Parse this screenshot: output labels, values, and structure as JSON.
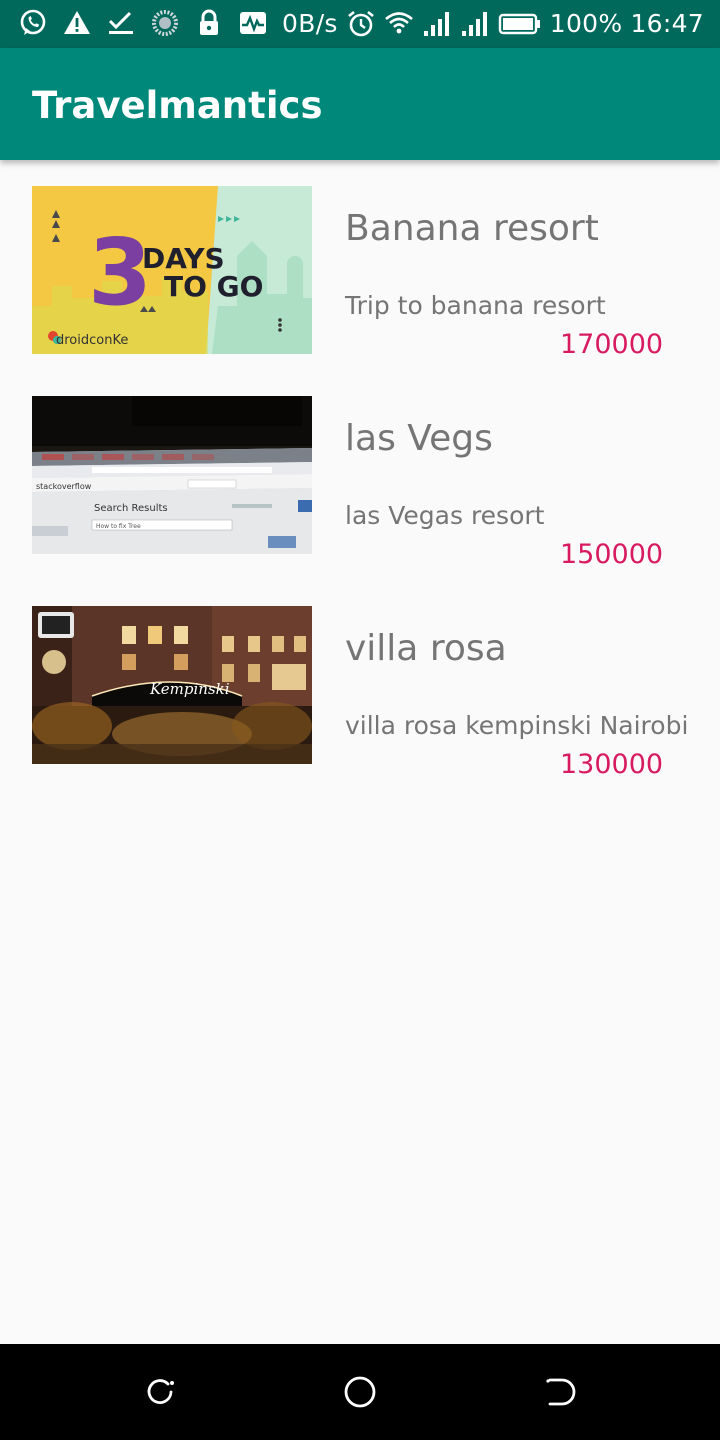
{
  "status_bar": {
    "left_icons": [
      "whatsapp-icon",
      "warning-icon",
      "checklist-icon",
      "sync-circle-icon",
      "lock-icon",
      "activity-icon"
    ],
    "net_speed": "0B/s",
    "right_icons": [
      "alarm-icon",
      "wifi-icon",
      "signal-icon",
      "signal-icon",
      "battery-icon"
    ],
    "battery": "100%",
    "time": "16:47",
    "color": "#00695c"
  },
  "app_bar": {
    "title": "Travelmantics",
    "color": "#00897b"
  },
  "deals": [
    {
      "title": "Banana resort",
      "description": "Trip to banana resort",
      "price": "170000",
      "image": {
        "name": "droidcon-banner-image",
        "text_big": "3",
        "text_days": "DAYS",
        "text_togo": "TO GO",
        "text_brand": "droidconKe"
      }
    },
    {
      "title": "las Vegs",
      "description": "las Vegas resort",
      "price": "150000",
      "image": {
        "name": "stackoverflow-screen-photo",
        "text_logo": "stackoverflow",
        "text_heading": "Search Results",
        "text_query": "How to fix Tree"
      }
    },
    {
      "title": "villa rosa",
      "description": "villa rosa kempinski Nairobi",
      "price": "130000",
      "image": {
        "name": "kempinski-hotel-photo",
        "text_sign": "Kempinski"
      }
    }
  ],
  "colors": {
    "price": "#d81b60",
    "text_secondary": "#757575",
    "background": "#fafafa"
  },
  "nav_bar": {
    "icons": [
      "recent-apps-icon",
      "home-icon",
      "back-icon"
    ]
  }
}
